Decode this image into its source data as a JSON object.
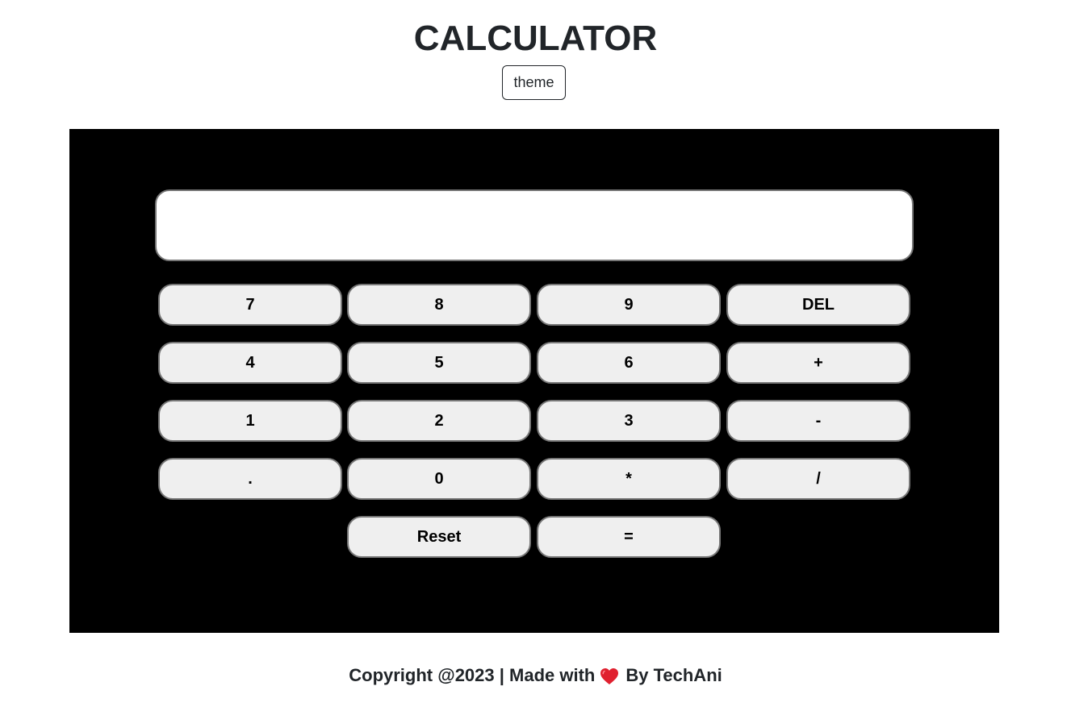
{
  "header": {
    "title": "CALCULATOR",
    "theme_label": "theme"
  },
  "display": {
    "value": ""
  },
  "keys": {
    "k7": "7",
    "k8": "8",
    "k9": "9",
    "del": "DEL",
    "k4": "4",
    "k5": "5",
    "k6": "6",
    "plus": "+",
    "k1": "1",
    "k2": "2",
    "k3": "3",
    "minus": "-",
    "dot": ".",
    "k0": "0",
    "multiply": "*",
    "divide": "/",
    "reset": "Reset",
    "equals": "="
  },
  "footer": {
    "copyright": "Copyright @2023 | Made with",
    "author": "By TechAni",
    "heart_icon": "heart-icon"
  },
  "colors": {
    "panel_bg": "#000000",
    "key_bg": "#efefef",
    "heart": "#e0202f"
  }
}
